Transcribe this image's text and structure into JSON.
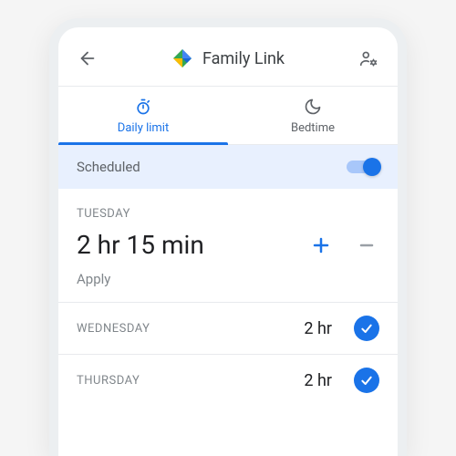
{
  "header": {
    "title": "Family Link"
  },
  "tabs": {
    "daily": "Daily limit",
    "bedtime": "Bedtime"
  },
  "scheduled": {
    "label": "Scheduled",
    "on": true
  },
  "focus_day": {
    "name": "TUESDAY",
    "time": "2 hr 15 min",
    "apply": "Apply"
  },
  "days": [
    {
      "name": "WEDNESDAY",
      "time": "2 hr"
    },
    {
      "name": "THURSDAY",
      "time": "2 hr"
    }
  ]
}
